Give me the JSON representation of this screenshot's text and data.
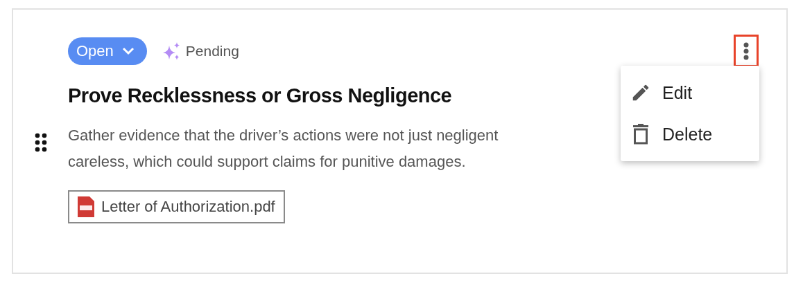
{
  "status": {
    "label": "Open",
    "expanded": false
  },
  "ai_status": {
    "label": "Pending"
  },
  "title": "Prove Recklessness or Gross Negligence",
  "description_lines": [
    "Gather evidence that the driver’s actions were not just negligent",
    "careless, which could support claims for punitive damages."
  ],
  "attachments": [
    {
      "name": "Letter of Authorization.pdf"
    }
  ],
  "menu": {
    "open": true,
    "items": [
      {
        "kind": "edit",
        "label": "Edit"
      },
      {
        "kind": "delete",
        "label": "Delete"
      }
    ]
  }
}
